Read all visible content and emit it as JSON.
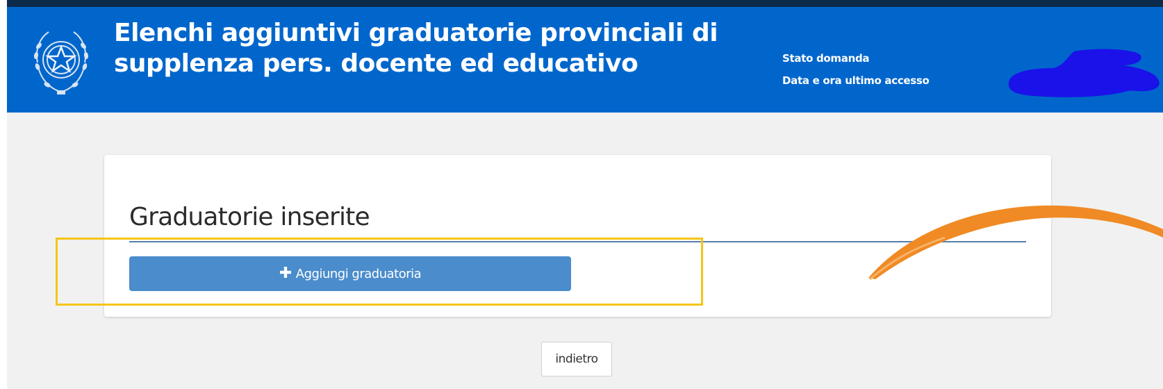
{
  "header": {
    "title_line1": "Elenchi aggiuntivi graduatorie provinciali di",
    "title_line2": "supplenza pers. docente ed educativo",
    "status_label": "Stato domanda",
    "last_access_label": "Data e ora ultimo accesso",
    "emblem_icon": "italian-republic-emblem-icon"
  },
  "card": {
    "title": "Graduatorie inserite",
    "add_button_label": "Aggiungi graduatoria",
    "add_button_icon": "plus-icon"
  },
  "footer": {
    "back_button_label": "indietro"
  },
  "colors": {
    "header_bg": "#0066cc",
    "top_strip": "#0c2a4a",
    "page_bg": "#f1f1f1",
    "button_bg": "#4a8ccc",
    "highlight_border": "#f5c518",
    "swoosh": "#f08a24",
    "redaction": "#1a12e8"
  }
}
